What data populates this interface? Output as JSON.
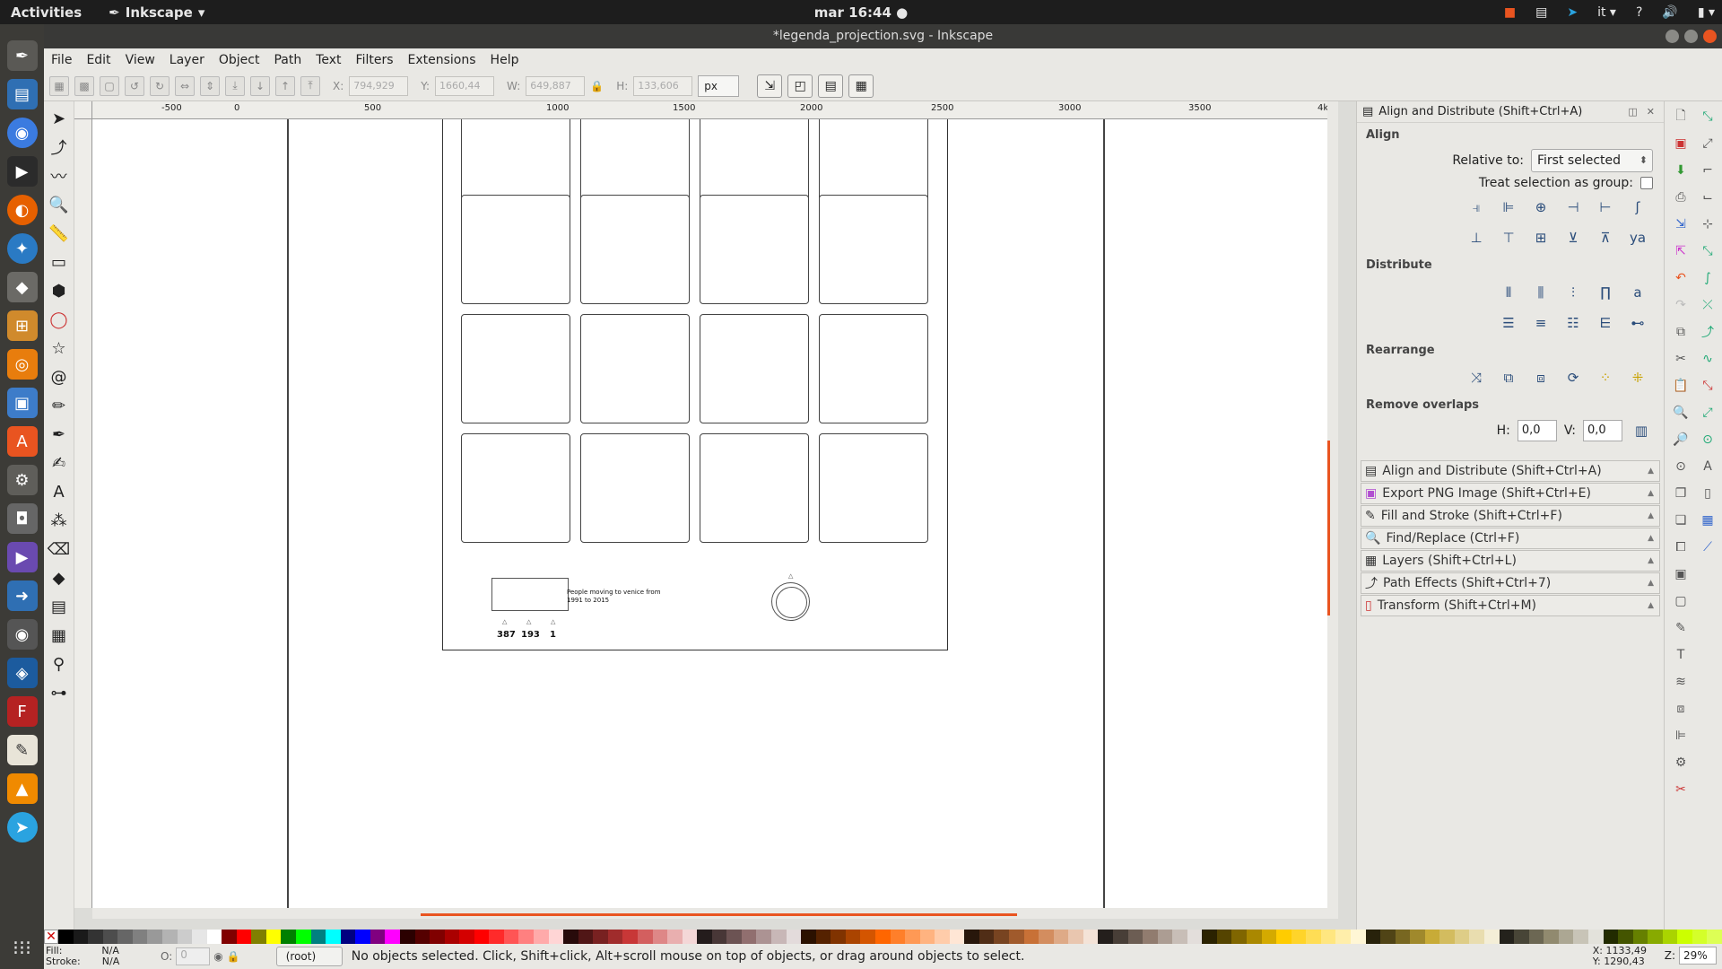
{
  "topbar": {
    "activities": "Activities",
    "app_name": "Inkscape",
    "clock": "mar 16:44",
    "lang": "it",
    "help": "?"
  },
  "window": {
    "title": "*legenda_projection.svg - Inkscape"
  },
  "menu": [
    "File",
    "Edit",
    "View",
    "Layer",
    "Object",
    "Path",
    "Text",
    "Filters",
    "Extensions",
    "Help"
  ],
  "toolbar": {
    "x_label": "X:",
    "x_value": "794,929",
    "y_label": "Y:",
    "y_value": "1660,44",
    "w_label": "W:",
    "w_value": "649,887",
    "h_label": "H:",
    "h_value": "133,606",
    "unit": "px"
  },
  "ruler": {
    "ticks": [
      "-500",
      "0",
      "500",
      "1000",
      "1500",
      "2000",
      "2500",
      "3000",
      "3500",
      "4k"
    ]
  },
  "canvas": {
    "legend_text": "People moving to venice from 1991 to 2015",
    "legend_numbers": [
      "387",
      "193",
      "1"
    ]
  },
  "panel": {
    "title": "Align and Distribute (Shift+Ctrl+A)",
    "align_heading": "Align",
    "relative_label": "Relative to:",
    "relative_value": "First selected",
    "treat_group_label": "Treat selection as group:",
    "distribute_heading": "Distribute",
    "rearrange_heading": "Rearrange",
    "remove_overlaps_heading": "Remove overlaps",
    "h_label": "H:",
    "h_value": "0,0",
    "v_label": "V:",
    "v_value": "0,0",
    "dialogs": [
      "Align and Distribute (Shift+Ctrl+A)",
      "Export PNG Image (Shift+Ctrl+E)",
      "Fill and Stroke (Shift+Ctrl+F)",
      "Find/Replace (Ctrl+F)",
      "Layers (Shift+Ctrl+L)",
      "Path Effects  (Shift+Ctrl+7)",
      "Transform (Shift+Ctrl+M)"
    ]
  },
  "status": {
    "fill_label": "Fill:",
    "fill_value": "N/A",
    "stroke_label": "Stroke:",
    "stroke_value": "N/A",
    "opacity_label": "O:",
    "opacity_value": "0",
    "layer": "(root)",
    "message": "No objects selected. Click, Shift+click, Alt+scroll mouse on top of objects, or drag around objects to select.",
    "x_coord": "X: 1133,49",
    "y_coord": "Y: 1290,43",
    "zoom_label": "Z:",
    "zoom_value": "29%"
  },
  "palette": [
    "#000000",
    "#1a1a1a",
    "#333333",
    "#4d4d4d",
    "#666666",
    "#808080",
    "#999999",
    "#b3b3b3",
    "#cccccc",
    "#e6e6e6",
    "#ffffff",
    "#800000",
    "#ff0000",
    "#808000",
    "#ffff00",
    "#008000",
    "#00ff00",
    "#008080",
    "#00ffff",
    "#000080",
    "#0000ff",
    "#800080",
    "#ff00ff",
    "#2b0000",
    "#550000",
    "#800000",
    "#aa0000",
    "#d40000",
    "#ff0000",
    "#ff2a2a",
    "#ff5555",
    "#ff8080",
    "#ffaaaa",
    "#ffd5d5",
    "#280b0b",
    "#501616",
    "#782121",
    "#a02c2c",
    "#c83737",
    "#d35f5f",
    "#de8787",
    "#e9afaf",
    "#f4d7d7",
    "#241c1c",
    "#483737",
    "#6c5353",
    "#916f6f",
    "#ac9393",
    "#c8b7b7",
    "#e3dbdb",
    "#2b1100",
    "#552200",
    "#803300",
    "#aa4400",
    "#d45500",
    "#ff6600",
    "#ff7f2a",
    "#ff9955",
    "#ffb380",
    "#ffccaa",
    "#ffe6d5",
    "#28170b",
    "#502d16",
    "#784421",
    "#a05a2c",
    "#c87137",
    "#d38d5f",
    "#deaa87",
    "#e9c6af",
    "#f4e3d7",
    "#241f1c",
    "#483e37",
    "#6c5d53",
    "#917c6f",
    "#ac9d93",
    "#c8beb7",
    "#e3dedb",
    "#2b2200",
    "#554400",
    "#806600",
    "#aa8800",
    "#d4aa00",
    "#ffcc00",
    "#ffd42a",
    "#ffdd55",
    "#ffe680",
    "#ffeeaa",
    "#fff6d5",
    "#28220b",
    "#504416",
    "#786721",
    "#a0892c",
    "#c8ab37",
    "#d3bc5f",
    "#decd87",
    "#e9ddaf",
    "#f4eed7",
    "#24221c",
    "#484537",
    "#6c6753",
    "#918a6f",
    "#aca793",
    "#c8c4b7",
    "#e3e2db",
    "#222b00",
    "#445500",
    "#668000",
    "#88aa00",
    "#aad400",
    "#ccff00",
    "#d4ff2a",
    "#ddff55"
  ],
  "colors": {
    "accent": "#e95420",
    "topbar": "#1d1d1d",
    "dock": "#3c3b37",
    "chrome": "#e9e8e4"
  }
}
